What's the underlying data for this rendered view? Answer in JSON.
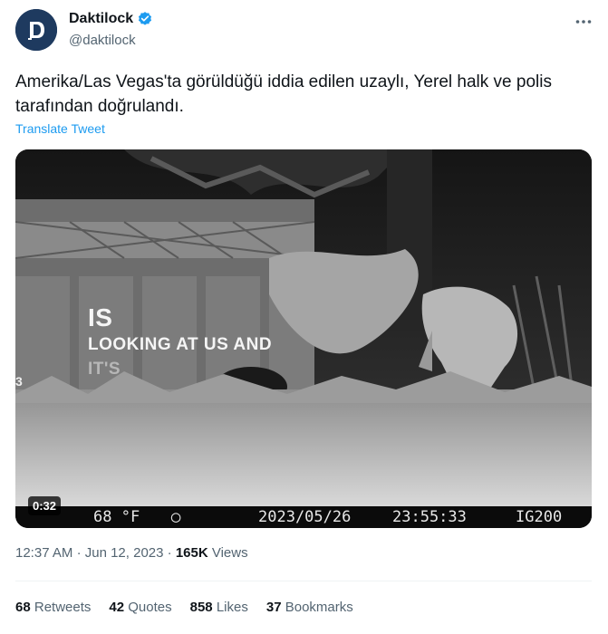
{
  "author": {
    "display_name": "Daktilock",
    "handle": "@daktilock",
    "avatar_letter": "D",
    "verified_color": "#1d9bf0"
  },
  "tweet": {
    "text": "Amerika/Las Vegas'ta görüldüğü iddia edilen uzaylı, Yerel halk ve polis tarafından doğrulandı.",
    "translate_label": "Translate Tweet"
  },
  "media": {
    "duration": "0:32",
    "caption_lines": [
      "IS",
      "LOOKING AT US AND",
      "IT'S"
    ],
    "left_edge_text": "3",
    "hud": {
      "temperature": "68 °F",
      "date": "2023/05/26",
      "time": "23:55:33",
      "camera_id": "IG200"
    }
  },
  "meta": {
    "time": "12:37 AM",
    "date": "Jun 12, 2023",
    "views_count": "165K",
    "views_label": "Views"
  },
  "stats": {
    "retweets_count": "68",
    "retweets_label": "Retweets",
    "quotes_count": "42",
    "quotes_label": "Quotes",
    "likes_count": "858",
    "likes_label": "Likes",
    "bookmarks_count": "37",
    "bookmarks_label": "Bookmarks"
  },
  "colors": {
    "link": "#1d9bf0",
    "secondary_text": "#536471",
    "avatar_bg": "#1e3a5f"
  }
}
